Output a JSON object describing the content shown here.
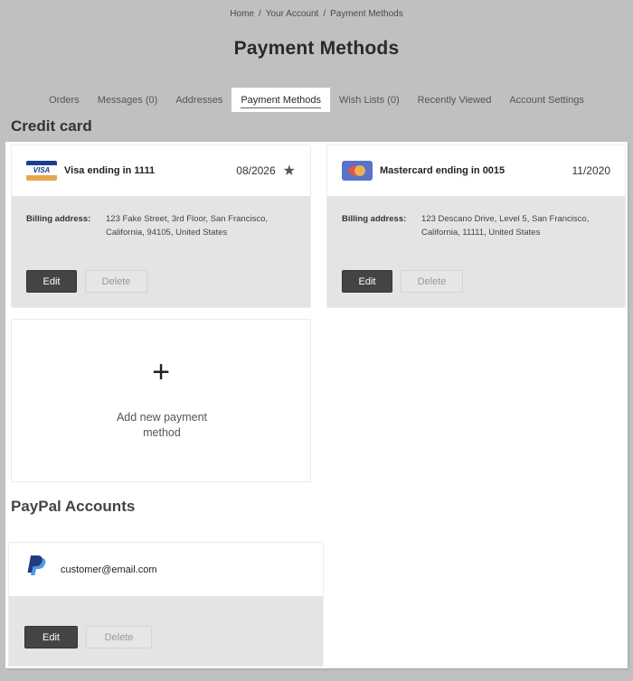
{
  "breadcrumb": [
    {
      "label": "Home"
    },
    {
      "label": "Your Account"
    },
    {
      "label": "Payment Methods"
    }
  ],
  "breadcrumb_separator": "/",
  "page_title": "Payment Methods",
  "nav": {
    "items": [
      {
        "label": "Orders"
      },
      {
        "label": "Messages (0)"
      },
      {
        "label": "Addresses"
      },
      {
        "label": "Payment Methods",
        "active": true
      },
      {
        "label": "Wish Lists (0)"
      },
      {
        "label": "Recently Viewed"
      },
      {
        "label": "Account Settings"
      }
    ]
  },
  "credit_card_section": {
    "title": "Credit card",
    "cards": [
      {
        "brand_icon": "visa-logo",
        "brand_text": "VISA",
        "name": "Visa ending in 1111",
        "expiry": "08/2026",
        "default_icon": "star-icon",
        "billing_label": "Billing address:",
        "billing_address": "123 Fake Street, 3rd Floor, San Francisco, California, 94105, United States",
        "edit_label": "Edit",
        "delete_label": "Delete"
      },
      {
        "brand_icon": "mastercard-logo",
        "name": "Mastercard ending in 0015",
        "expiry": "11/2020",
        "billing_label": "Billing address:",
        "billing_address": "123 Descano Drive, Level 5, San Francisco, California, 11111, United States",
        "edit_label": "Edit",
        "delete_label": "Delete"
      }
    ],
    "add_new": {
      "icon": "plus-icon",
      "icon_glyph": "+",
      "label": "Add new payment method"
    }
  },
  "paypal_section": {
    "title": "PayPal Accounts",
    "accounts": [
      {
        "brand_icon": "paypal-logo",
        "email": "customer@email.com",
        "edit_label": "Edit",
        "delete_label": "Delete"
      }
    ]
  },
  "colors": {
    "page_background": "#c0c0c0",
    "panel_background": "#ffffff",
    "card_body": "#e4e4e4",
    "edit_button": "#444444",
    "visa_blue": "#1d3f8f",
    "visa_gold": "#e8a84a",
    "mastercard_bg": "#5a73c7",
    "paypal_dark": "#253b80",
    "paypal_light": "#4a9ee0"
  }
}
